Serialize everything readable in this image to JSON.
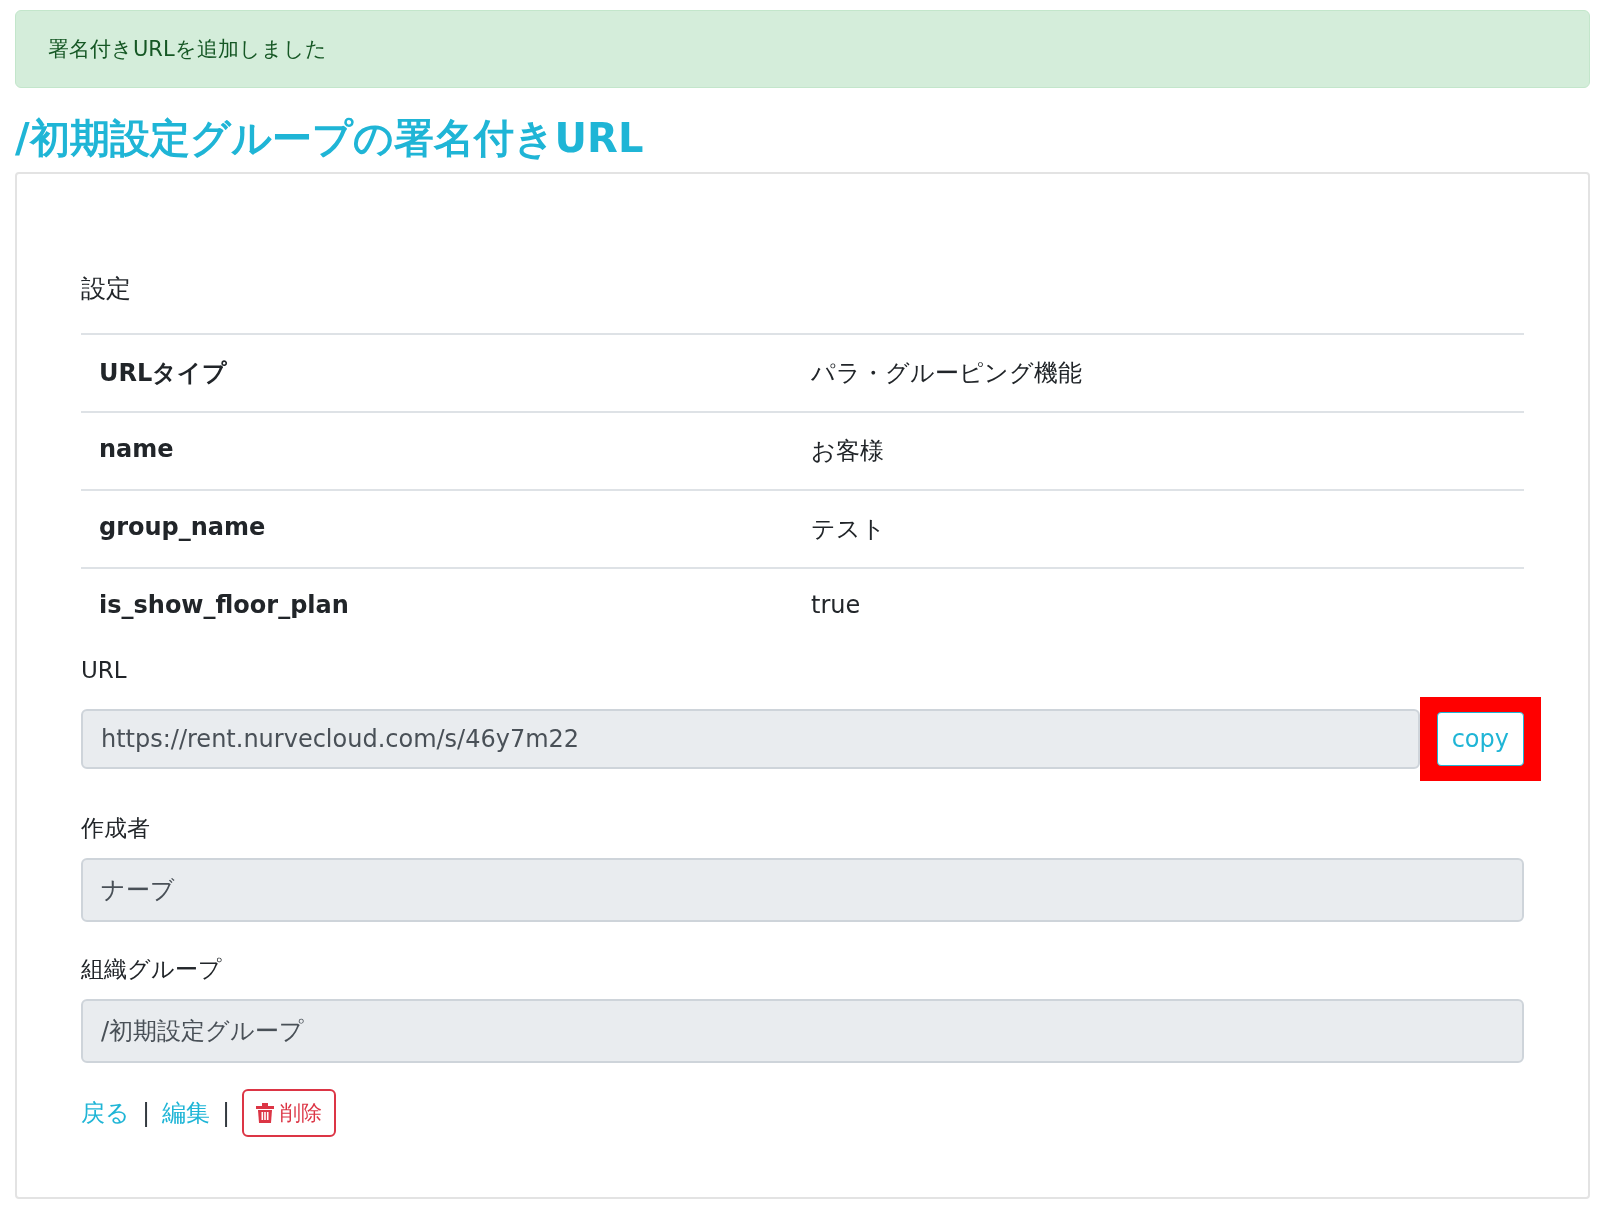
{
  "alert": {
    "message": "署名付きURLを追加しました"
  },
  "title": "/初期設定グループの署名付きURL",
  "section": {
    "heading": "設定",
    "rows": [
      {
        "key": "URLタイプ",
        "value": "パラ・グルーピング機能"
      },
      {
        "key": "name",
        "value": "お客様"
      },
      {
        "key": "group_name",
        "value": "テスト"
      },
      {
        "key": "is_show_floor_plan",
        "value": "true"
      }
    ]
  },
  "fields": [
    {
      "label": "URL",
      "value": "https://rent.nurvecloud.com/s/46y7m22",
      "button": {
        "label": "copy",
        "highlighted": true
      }
    },
    {
      "label": "作成者",
      "value": "ナーブ"
    },
    {
      "label": "組織グループ",
      "value": "/初期設定グループ"
    }
  ],
  "actions": [
    {
      "kind": "link",
      "label": "戻る"
    },
    {
      "kind": "separator",
      "label": "|"
    },
    {
      "kind": "link",
      "label": "編集"
    },
    {
      "kind": "separator",
      "label": "|"
    },
    {
      "kind": "danger-button",
      "label": "削除"
    }
  ]
}
